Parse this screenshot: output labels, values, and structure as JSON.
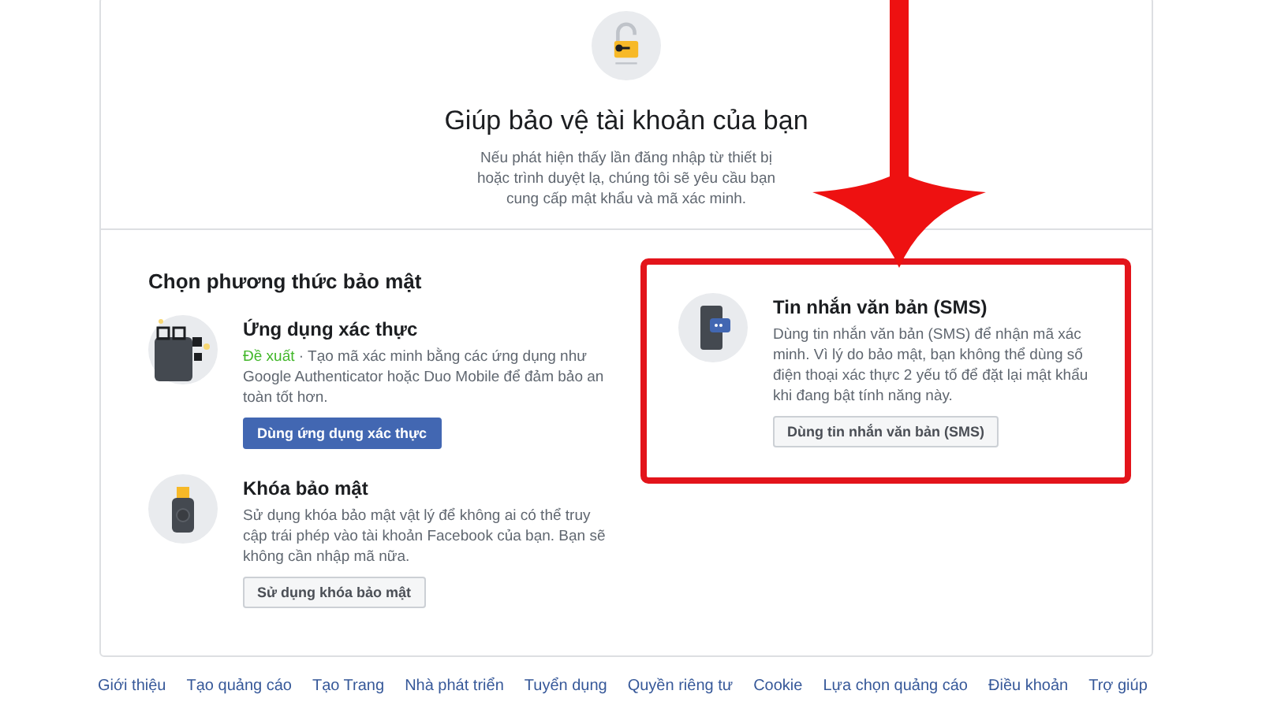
{
  "intro": {
    "title": "Giúp bảo vệ tài khoản của bạn",
    "text": "Nếu phát hiện thấy lần đăng nhập từ thiết bị hoặc trình duyệt lạ, chúng tôi sẽ yêu cầu bạn cung cấp mật khẩu và mã xác minh."
  },
  "section_title": "Chọn phương thức bảo mật",
  "methods": [
    {
      "kind": "app",
      "title": "Ứng dụng xác thực",
      "badge": "Đề xuất",
      "description": " · Tạo mã xác minh bằng các ứng dụng như Google Authenticator hoặc Duo Mobile để đảm bảo an toàn tốt hơn.",
      "button": "Dùng ứng dụng xác thực",
      "primary": true,
      "highlighted": false
    },
    {
      "kind": "sms",
      "title": "Tin nhắn văn bản (SMS)",
      "description": "Dùng tin nhắn văn bản (SMS) để nhận mã xác minh. Vì lý do bảo mật, bạn không thể dùng số điện thoại xác thực 2 yếu tố để đặt lại mật khẩu khi đang bật tính năng này.",
      "button": "Dùng tin nhắn văn bản (SMS)",
      "primary": false,
      "highlighted": true
    },
    {
      "kind": "key",
      "title": "Khóa bảo mật",
      "description": "Sử dụng khóa bảo mật vật lý để không ai có thể truy cập trái phép vào tài khoản Facebook của bạn. Bạn sẽ không cần nhập mã nữa.",
      "button": "Sử dụng khóa bảo mật",
      "primary": false,
      "highlighted": false
    }
  ],
  "footer_links": [
    "Giới thiệu",
    "Tạo quảng cáo",
    "Tạo Trang",
    "Nhà phát triển",
    "Tuyển dụng",
    "Quyền riêng tư",
    "Cookie",
    "Lựa chọn quảng cáo",
    "Điều khoản",
    "Trợ giúp"
  ]
}
